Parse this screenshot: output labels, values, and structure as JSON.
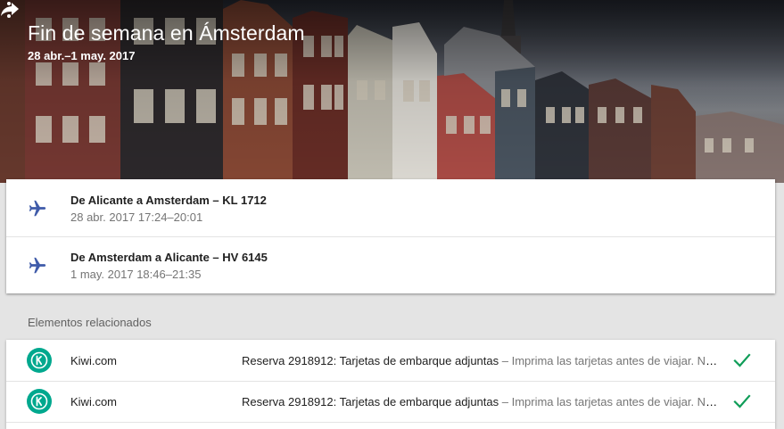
{
  "header": {
    "title": "Fin de semana en Ámsterdam",
    "dates": "28 abr.–1 may. 2017",
    "icons": {
      "share": "share-icon",
      "more": "more-vert-icon"
    }
  },
  "flights": [
    {
      "title": "De Alicante a Amsterdam – KL 1712",
      "time": "28 abr. 2017 17:24–20:01",
      "icon": "airplane-icon"
    },
    {
      "title": "De Amsterdam a Alicante – HV 6145",
      "time": "1 may. 2017 18:46–21:35",
      "icon": "airplane-icon"
    }
  ],
  "related": {
    "heading": "Elementos relacionados",
    "items": [
      {
        "sender": "Kiwi.com",
        "subject": "Reserva 2918912: Tarjetas de embarque adjuntas",
        "snippet": " – Imprima las tarjetas antes de viajar. Nú…",
        "status_icon": "check-icon"
      },
      {
        "sender": "Kiwi.com",
        "subject": "Reserva 2918912: Tarjetas de embarque adjuntas",
        "snippet": " – Imprima las tarjetas antes de viajar. Nú…",
        "status_icon": "check-icon"
      }
    ]
  },
  "colors": {
    "plane_icon": "#3f5ba9",
    "kiwi_brand": "#00a88e",
    "check": "#0f9d58"
  }
}
